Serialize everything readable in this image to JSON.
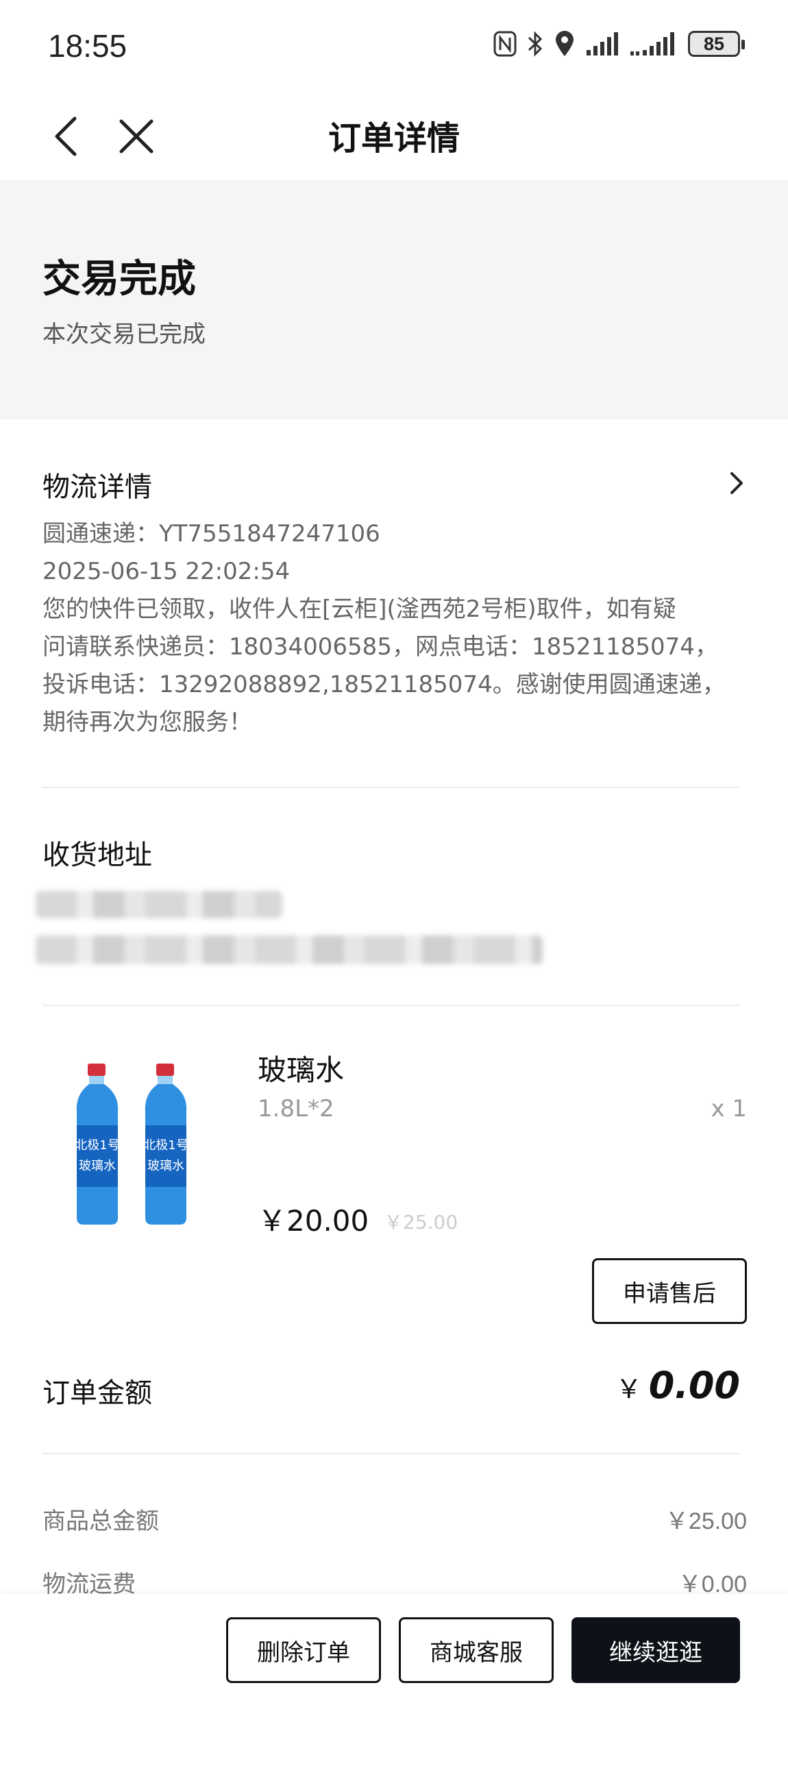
{
  "status_bar": {
    "time": "18:55",
    "battery": "85",
    "icons": [
      "nfc-icon",
      "bluetooth-icon",
      "location-icon",
      "signal-icon",
      "signal-icon-2",
      "battery-icon"
    ]
  },
  "nav": {
    "title": "订单详情",
    "back_icon": "back-arrow-icon",
    "close_icon": "close-icon"
  },
  "order_status": {
    "title": "交易完成",
    "subtitle": "本次交易已完成"
  },
  "logistics": {
    "title": "物流详情",
    "carrier_line": "圆通速递：YT7551847247106",
    "time": "2025-06-15 22:02:54",
    "message_lines": [
      "您的快件已领取，收件人在[云柜](滏西苑2号柜)取件，如有疑",
      "问请联系快递员：18034006585，网点电话：18521185074，",
      "投诉电话：13292088892,18521185074。感谢使用圆通速递，",
      "期待再次为您服务！"
    ]
  },
  "address": {
    "title": "收货地址"
  },
  "product": {
    "name": "玻璃水",
    "spec": "1.8L*2",
    "quantity": "x 1",
    "price": "￥20.00",
    "original_price": "￥25.00",
    "image_label_1": "北极1号",
    "image_label_2": "玻璃水",
    "after_sales_label": "申请售后"
  },
  "amount": {
    "label": "订单金额",
    "currency": "￥",
    "value": "0.00"
  },
  "summary_rows": [
    {
      "label": "商品总金额",
      "value": "￥25.00"
    },
    {
      "label": "物流运费",
      "value": "￥0.00"
    }
  ],
  "bottom_bar": {
    "delete_label": "删除订单",
    "service_label": "商城客服",
    "continue_label": "继续逛逛"
  },
  "colors": {
    "dark_button": "#0e1118",
    "panel_bg": "#f5f5f5",
    "bottle_blue": "#2f8fe0"
  }
}
